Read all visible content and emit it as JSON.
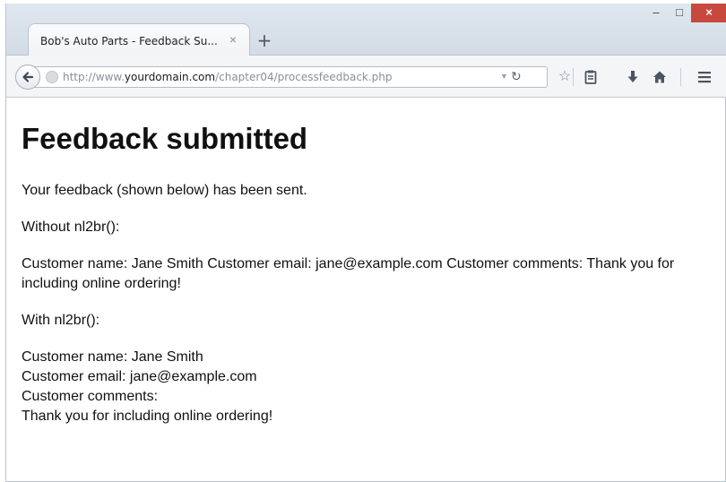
{
  "browser": {
    "tab_title": "Bob's Auto Parts - Feedback Su...",
    "tab_close_glyph": "×",
    "new_tab_glyph": "+",
    "window_controls": {
      "minimize": "–",
      "maximize": "□",
      "close": "×"
    },
    "url": {
      "prefix": "http://www.",
      "domain": "yourdomain.com",
      "path": "/chapter04/processfeedback.php"
    },
    "icons": [
      "back-arrow-icon",
      "site-identity-icon",
      "dropdown-arrow-icon",
      "reload-icon",
      "bookmark-star-icon",
      "reader-view-icon",
      "download-icon",
      "home-icon",
      "menu-icon"
    ]
  },
  "page": {
    "title": "Feedback submitted",
    "sent_message": "Your feedback (shown below) has been sent.",
    "without_label": "Without nl2br():",
    "without_text": "Customer name: Jane Smith Customer email: jane@example.com Customer comments: Thank you for including online ordering!",
    "with_label": "With nl2br():",
    "with_lines": [
      "Customer name: Jane Smith",
      "Customer email: jane@example.com",
      "Customer comments:",
      "Thank you for including online ordering!"
    ]
  }
}
